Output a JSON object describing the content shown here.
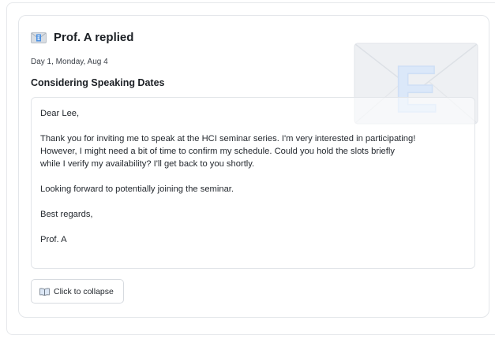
{
  "card": {
    "header": {
      "icon": "envelope-icon",
      "title": "Prof. A replied"
    },
    "date": "Day 1, Monday, Aug 4",
    "subject": "Considering Speaking Dates",
    "body": {
      "greeting": "Dear Lee,",
      "paragraph_lines": [
        "Thank you for inviting me to speak at the HCI seminar series. I'm very interested in participating!",
        "However, I might need a bit of time to confirm my schedule. Could you hold the slots briefly",
        "while I verify my availability? I'll get back to you shortly."
      ],
      "closing_line": "Looking forward to potentially joining the seminar.",
      "sign_off": "Best regards,",
      "signature": "Prof. A"
    },
    "collapse_button": {
      "icon": "open-book-icon",
      "label": "Click to collapse"
    },
    "decoration": {
      "icon": "envelope-e-icon",
      "letter": "E",
      "envelope_color": "#eef0f3",
      "letter_color": "#dbe8f9"
    }
  }
}
